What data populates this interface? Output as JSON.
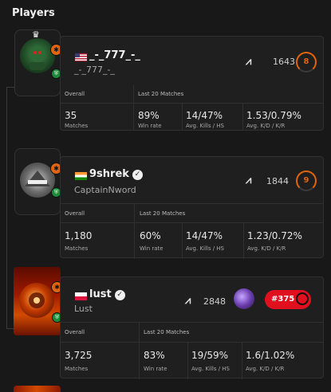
{
  "section_title": "Players",
  "overall_label": "Overall",
  "last20_label": "Last 20 Matches",
  "labels": {
    "matches": "Matches",
    "winrate": "Win rate",
    "kills_hs": "Avg. Kills / HS",
    "kd_kr": "Avg. K/D / K/R"
  },
  "players": [
    {
      "nickname": "_-_777_-_",
      "realname": "_-_777_-_",
      "country_flag": "us",
      "verified": false,
      "elo": "1643",
      "level": "8",
      "matches": "35",
      "winrate": "89%",
      "kills_hs": "14/47%",
      "kd_kr": "1.53/0.79%"
    },
    {
      "nickname": "9shrek",
      "realname": "CaptainNword",
      "country_flag": "in",
      "verified": true,
      "elo": "1844",
      "level": "9",
      "matches": "1,180",
      "winrate": "60%",
      "kills_hs": "14/47%",
      "kd_kr": "1.23/0.72%"
    },
    {
      "nickname": "lust",
      "realname": "Lust",
      "country_flag": "pl",
      "verified": true,
      "elo": "2848",
      "rank": "#375",
      "matches": "3,725",
      "winrate": "83%",
      "kills_hs": "19/59%",
      "kd_kr": "1.6/1.02%"
    }
  ],
  "colors": {
    "background": "#181818",
    "card": "#1f1f1f",
    "accent_orange": "#e2640e",
    "rank_red": "#e0101e"
  }
}
